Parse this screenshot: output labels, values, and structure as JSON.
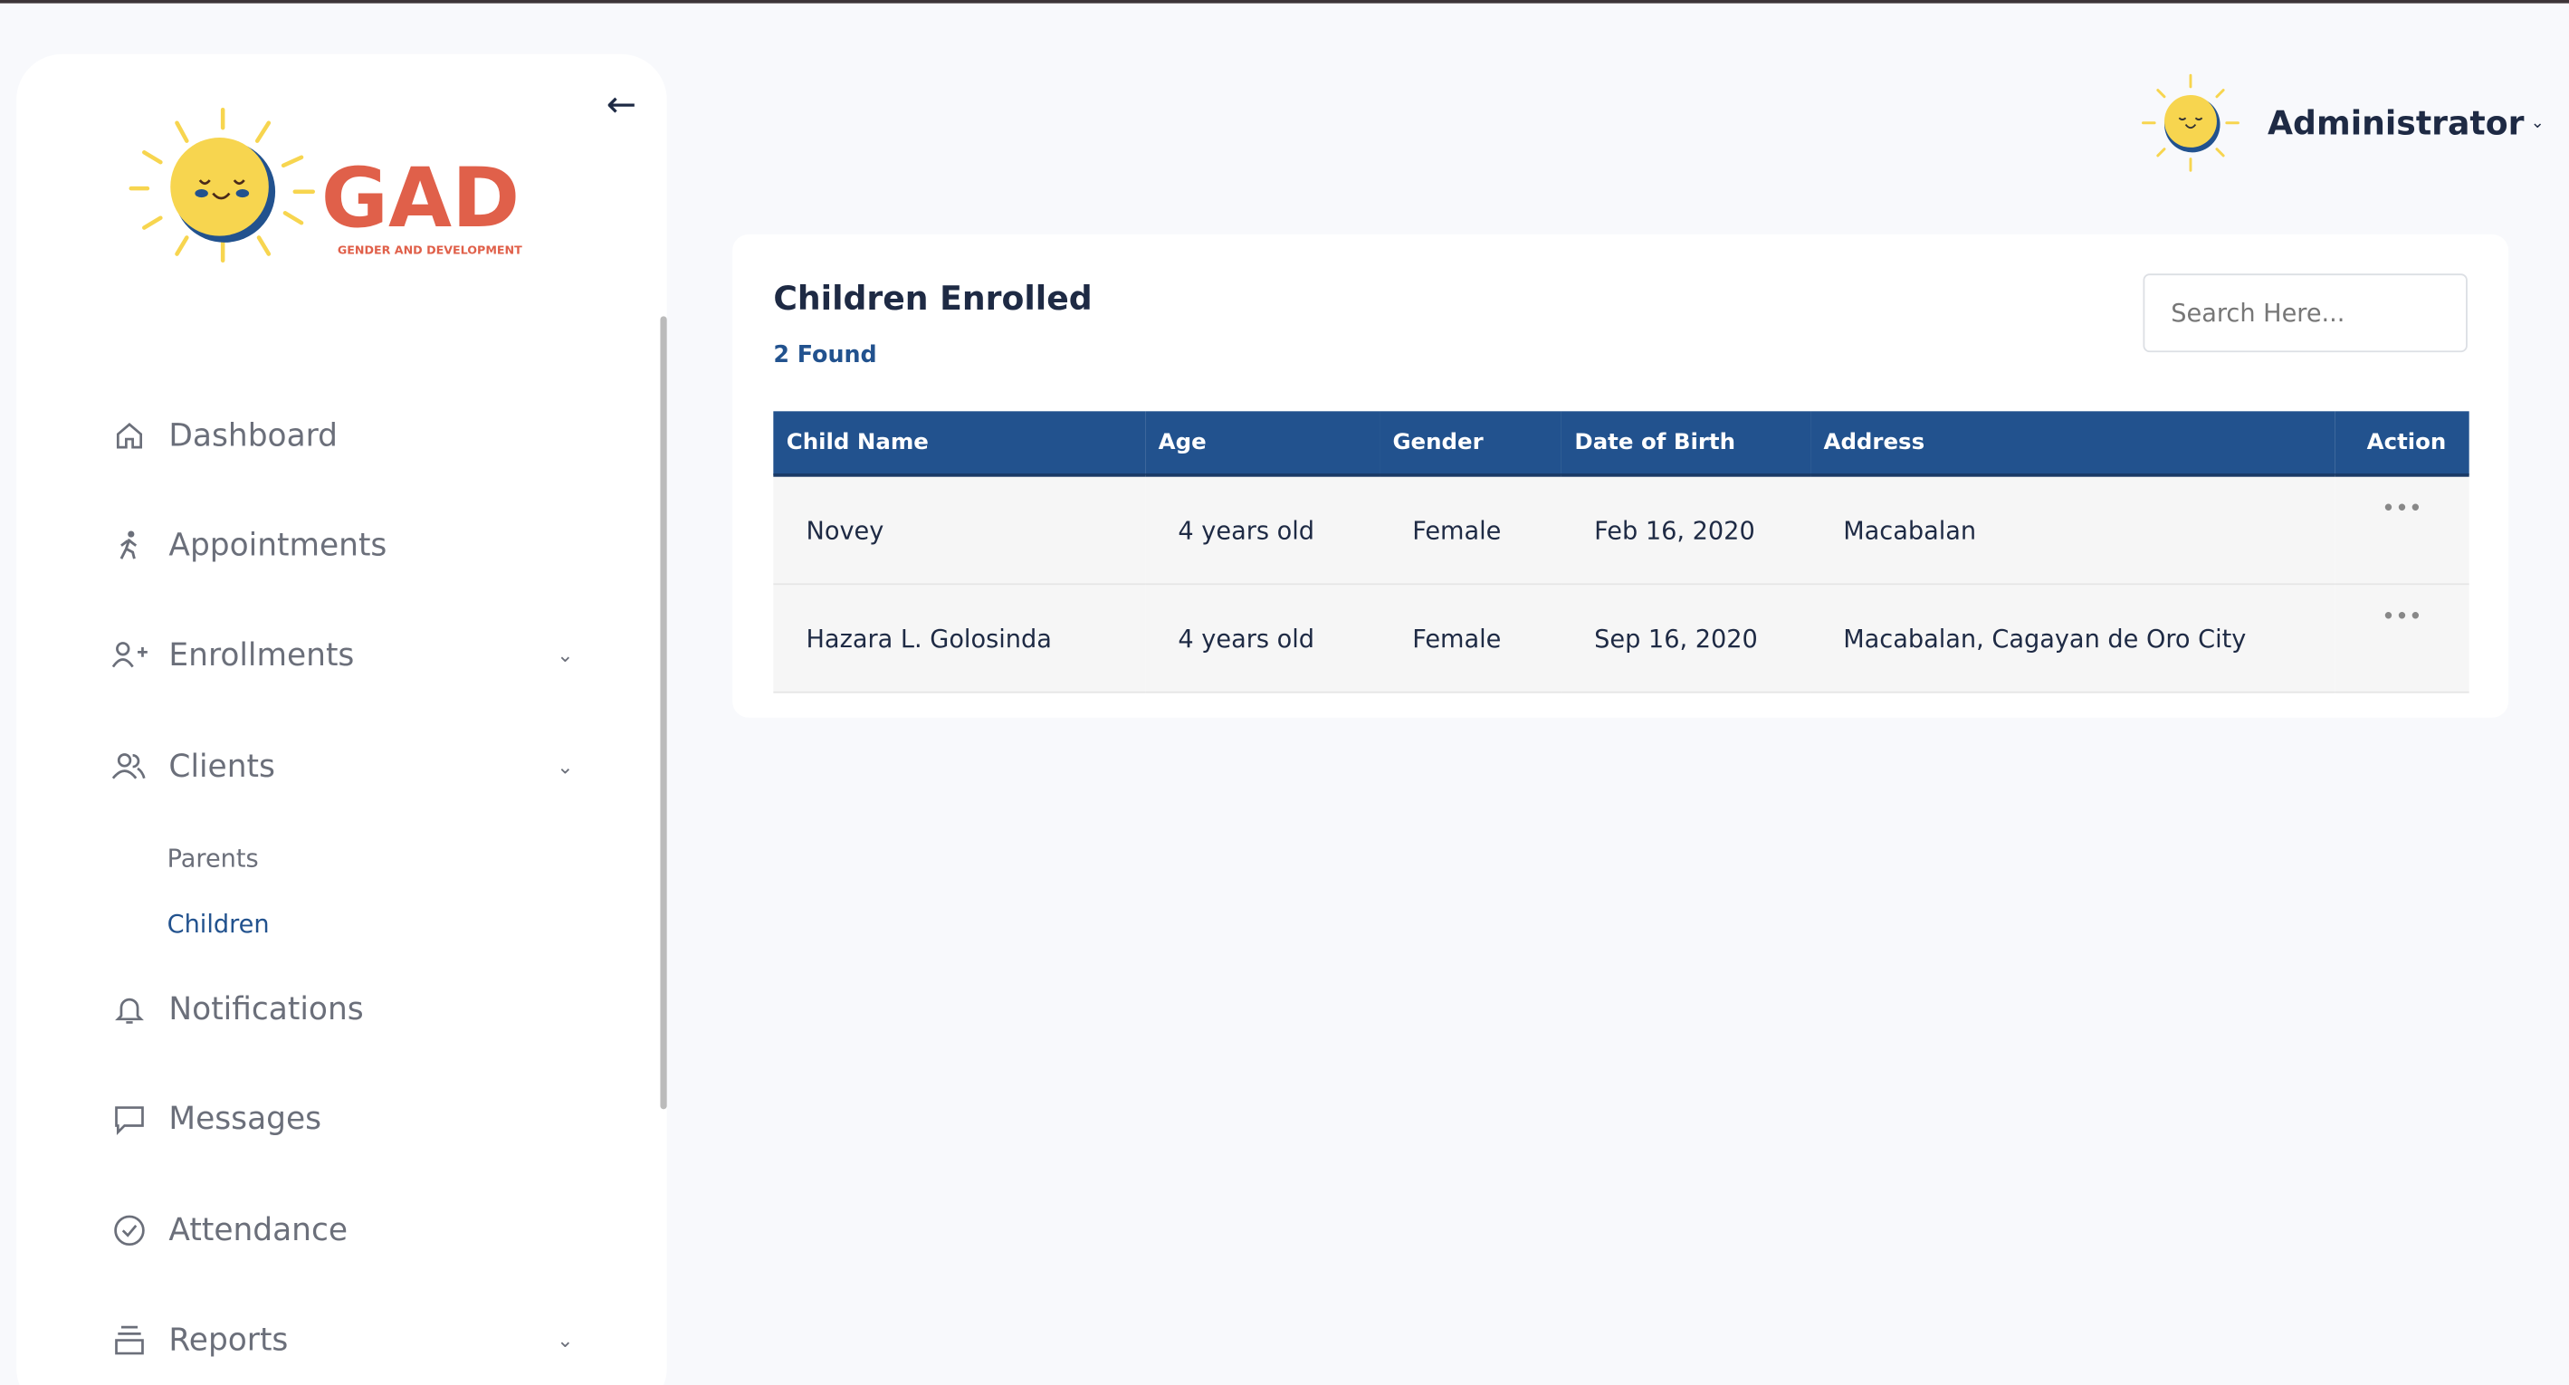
{
  "sidebar": {
    "logo_text": "GAD",
    "logo_subtitle": "GENDER AND DEVELOPMENT",
    "items": [
      {
        "label": "Dashboard",
        "icon": "home-icon"
      },
      {
        "label": "Appointments",
        "icon": "walking-person-icon"
      },
      {
        "label": "Enrollments",
        "icon": "user-plus-icon",
        "expandable": true
      },
      {
        "label": "Clients",
        "icon": "users-icon",
        "expandable": true,
        "children": [
          {
            "label": "Parents"
          },
          {
            "label": "Children",
            "active": true
          }
        ]
      },
      {
        "label": "Notifications",
        "icon": "bell-icon"
      },
      {
        "label": "Messages",
        "icon": "message-icon"
      },
      {
        "label": "Attendance",
        "icon": "check-circle-icon"
      },
      {
        "label": "Reports",
        "icon": "stack-icon",
        "expandable": true
      }
    ]
  },
  "header": {
    "user": "Administrator"
  },
  "main": {
    "title": "Children Enrolled",
    "count": "2 Found",
    "search": {
      "placeholder": "Search Here...",
      "value": ""
    },
    "columns": [
      "Child Name",
      "Age",
      "Gender",
      "Date of Birth",
      "Address",
      "Action"
    ],
    "rows": [
      [
        "Novey",
        "4 years old",
        "Female",
        "Feb 16, 2020",
        "Macabalan",
        "•••"
      ],
      [
        "Hazara L. Golosinda",
        "4 years old",
        "Female",
        "Sep 16, 2020",
        "Macabalan, Cagayan de Oro City",
        "•••"
      ]
    ]
  },
  "colors": {
    "primary": "#22528e",
    "logo_red": "#e0604a",
    "sun_yellow": "#f7d54f"
  }
}
